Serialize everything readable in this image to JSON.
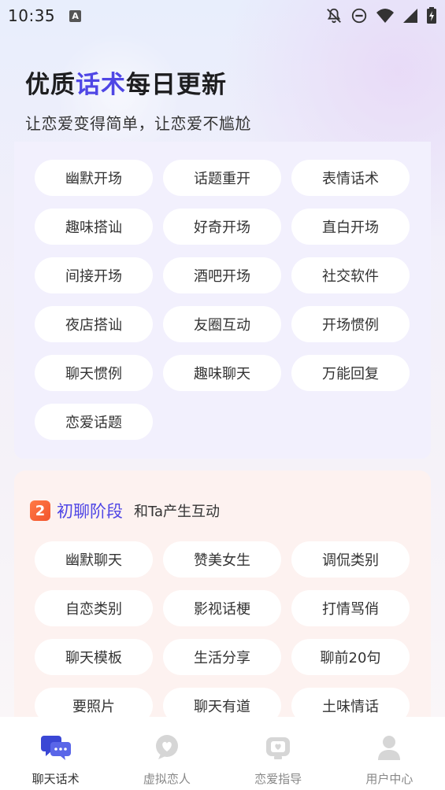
{
  "status_bar": {
    "time": "10:35",
    "notification_icon": "A",
    "icons": [
      "notifications-off-icon",
      "do-not-disturb-icon",
      "wifi-icon",
      "signal-icon",
      "battery-charging-icon"
    ]
  },
  "header": {
    "headline_part1": "优质",
    "headline_accent": "话术",
    "headline_part2": "每日更新",
    "subline": "让恋爱变得简单，让恋爱不尴尬"
  },
  "section1": {
    "chips": [
      "幽默开场",
      "话题重开",
      "表情话术",
      "趣味搭讪",
      "好奇开场",
      "直白开场",
      "间接开场",
      "酒吧开场",
      "社交软件",
      "夜店搭讪",
      "友圈互动",
      "开场惯例",
      "聊天惯例",
      "趣味聊天",
      "万能回复",
      "恋爱话题"
    ]
  },
  "section2": {
    "badge": "2",
    "title": "初聊阶段",
    "subtitle": "和Ta产生互动",
    "chips": [
      "幽默聊天",
      "赞美女生",
      "调侃类别",
      "自恋类别",
      "影视话梗",
      "打情骂俏",
      "聊天模板",
      "生活分享",
      "聊前20句",
      "要照片",
      "聊天有道",
      "土味情话"
    ]
  },
  "tabbar": {
    "tabs": [
      {
        "label": "聊天话术",
        "icon": "chat-bubbles-icon",
        "active": true
      },
      {
        "label": "虚拟恋人",
        "icon": "heart-bubble-icon",
        "active": false
      },
      {
        "label": "恋爱指导",
        "icon": "heart-tv-icon",
        "active": false
      },
      {
        "label": "用户中心",
        "icon": "user-icon",
        "active": false
      }
    ]
  },
  "colors": {
    "accent": "#4f46e5",
    "active_tab": "#3a47d5",
    "inactive_tab": "#d6d6d6",
    "badge": "#f2542d"
  }
}
